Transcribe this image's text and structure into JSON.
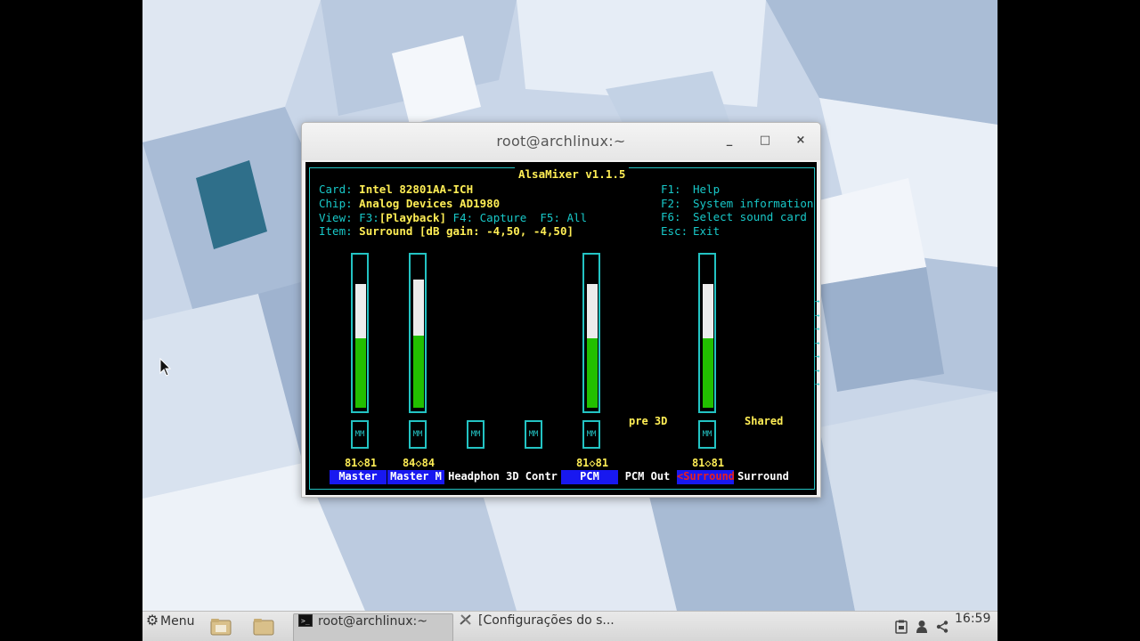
{
  "window": {
    "title": "root@archlinux:~",
    "minimize_glyph": "_",
    "maximize_glyph": "□",
    "close_glyph": "×"
  },
  "alsamixer": {
    "title": "AlsaMixer v1.1.5",
    "card_label": "Card:",
    "card_value": "Intel 82801AA-ICH",
    "chip_label": "Chip:",
    "chip_value": "Analog Devices AD1980",
    "view_label": "View:",
    "view_f3": "F3:",
    "view_playback": "[Playback]",
    "view_f4": "F4: Capture",
    "view_f5": "F5: All",
    "item_label": "Item:",
    "item_value": "Surround [dB gain: -4,50, -4,50]",
    "keys": [
      {
        "key": "F1:",
        "action": "Help"
      },
      {
        "key": "F2:",
        "action": "System information"
      },
      {
        "key": "F6:",
        "action": "Select sound card"
      },
      {
        "key": "Esc:",
        "action": "Exit"
      }
    ],
    "channels": [
      {
        "name": "Master",
        "level": 0.81,
        "values": "81◇81",
        "mute": "MM"
      },
      {
        "name": "Master M",
        "level": 0.84,
        "values": "84◇84",
        "mute": "MM"
      },
      {
        "name": "Headphon",
        "mute": "MM"
      },
      {
        "name": "3D Contr",
        "mute": "MM"
      },
      {
        "name": "PCM",
        "level": 0.81,
        "values": "81◇81",
        "mute": "MM"
      },
      {
        "name": "PCM Out",
        "extra": "pre 3D"
      },
      {
        "name": "<Surround>",
        "level": 0.81,
        "values": "81◇81",
        "mute": "MM"
      },
      {
        "name": "Surround",
        "extra": "Shared"
      }
    ],
    "scroll_arrows": [
      "→",
      "→",
      "→",
      "→",
      "→",
      "→",
      "→"
    ]
  },
  "taskbar": {
    "menu_label": "Menu",
    "tasks": [
      {
        "label": "root@archlinux:~"
      },
      {
        "label": "[Configurações do s..."
      }
    ],
    "clock": "16:59"
  },
  "colors": {
    "terminal_border": "#23c3c3",
    "terminal_text": "#ffee55",
    "volume_green": "#22c000",
    "selected_name": "#e82020",
    "name_bg": "#1818f0"
  }
}
